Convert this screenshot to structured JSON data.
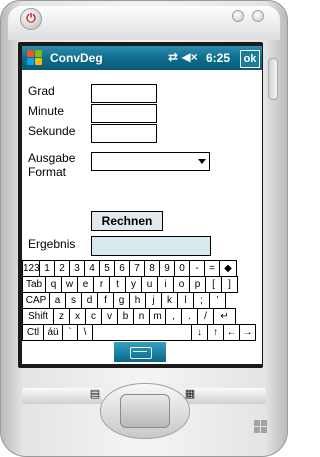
{
  "titlebar": {
    "app_title": "ConvDeg",
    "status_icons": "⇄ ◀×",
    "time": "6:25",
    "ok_label": "ok"
  },
  "form": {
    "grad_label": "Grad",
    "minute_label": "Minute",
    "sekunde_label": "Sekunde",
    "ausgabe_label_line1": "Ausgabe",
    "ausgabe_label_line2": "Format",
    "grad_value": "",
    "minute_value": "",
    "sekunde_value": "",
    "format_selected": "",
    "calculate_label": "Rechnen",
    "result_label": "Ergebnis",
    "result_value": ""
  },
  "keyboard": {
    "rows": [
      [
        "123",
        "1",
        "2",
        "3",
        "4",
        "5",
        "6",
        "7",
        "8",
        "9",
        "0",
        "-",
        "=",
        "◆"
      ],
      [
        "Tab",
        "q",
        "w",
        "e",
        "r",
        "t",
        "y",
        "u",
        "i",
        "o",
        "p",
        "[",
        "]"
      ],
      [
        "CAP",
        "a",
        "s",
        "d",
        "f",
        "g",
        "h",
        "j",
        "k",
        "l",
        ";",
        "'"
      ],
      [
        "Shift",
        "z",
        "x",
        "c",
        "v",
        "b",
        "n",
        "m",
        ",",
        ".",
        "/",
        "↵"
      ],
      [
        "Ctl",
        "áü",
        "`",
        "\\",
        "",
        "↓",
        "↑",
        "←",
        "→"
      ]
    ]
  },
  "hardware": {
    "power_symbol": "⏻",
    "left_softkey_icon": "▤",
    "right_softkey_icon": "▦"
  },
  "colors": {
    "titlebar": "#0f6d8e",
    "result_bg": "#d7e8ef",
    "button_bg": "#dfe9ee",
    "device_body": "#e4e4e4"
  }
}
